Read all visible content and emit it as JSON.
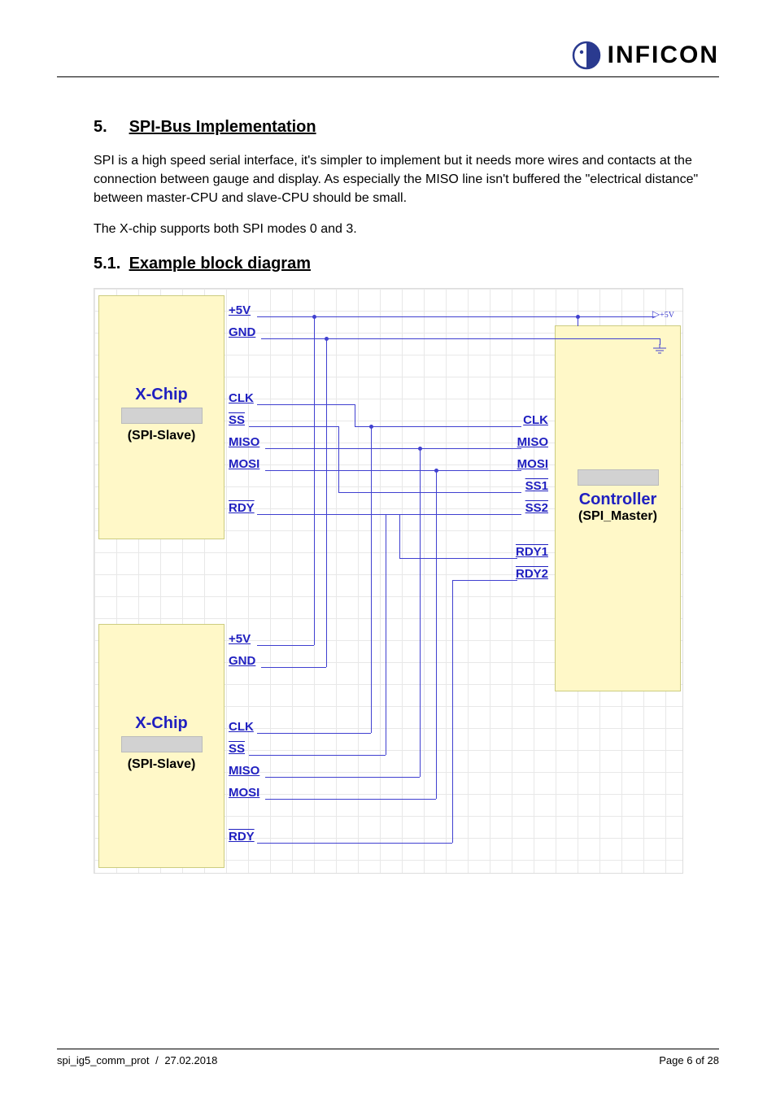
{
  "header": {
    "company": "INFICON"
  },
  "section_bus": {
    "num": "5.",
    "title": "SPI-Bus Implementation",
    "para1": "SPI is a high speed serial interface, it's simpler to implement but it needs more wires and contacts at the connection between gauge and display. As especially the MISO line isn't buffered the \"electrical distance\" between master-CPU and slave-CPU should be small.",
    "para2": "The X-chip supports both SPI modes 0 and 3."
  },
  "section_diagram": {
    "num": "5.1.",
    "title": "Example block diagram"
  },
  "diagram": {
    "block_xchip_title": "X-Chip",
    "block_xchip_sub": "(SPI-Slave)",
    "block_ctrl_title": "Controller",
    "block_ctrl_sub": "(SPI_Master)",
    "pins": {
      "p5v": "+5V",
      "gnd": "GND",
      "clk": "CLK",
      "ss": "SS",
      "miso": "MISO",
      "mosi": "MOSI",
      "rdy": "RDY",
      "ss1": "SS1",
      "ss2": "SS2",
      "rdy1": "RDY1",
      "rdy2": "RDY2"
    },
    "pwr_label": "+5V"
  },
  "footer": {
    "left_doc": "spi_ig5_comm_prot",
    "left_date": "27.02.2018",
    "right_page": "Page 6 of 28"
  }
}
